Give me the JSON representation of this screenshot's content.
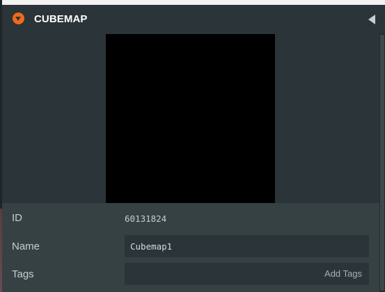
{
  "panel": {
    "title": "CUBEMAP",
    "accent_color": "#f06a1a",
    "collapse_icon": "chevron-down-circle-icon",
    "toggle_icon": "triangle-left-icon"
  },
  "preview": {
    "background_color": "#000000"
  },
  "properties": {
    "id_label": "ID",
    "id_value": "60131824",
    "name_label": "Name",
    "name_value": "Cubemap1",
    "tags_label": "Tags",
    "tags_value": "",
    "add_tags_label": "Add Tags"
  }
}
